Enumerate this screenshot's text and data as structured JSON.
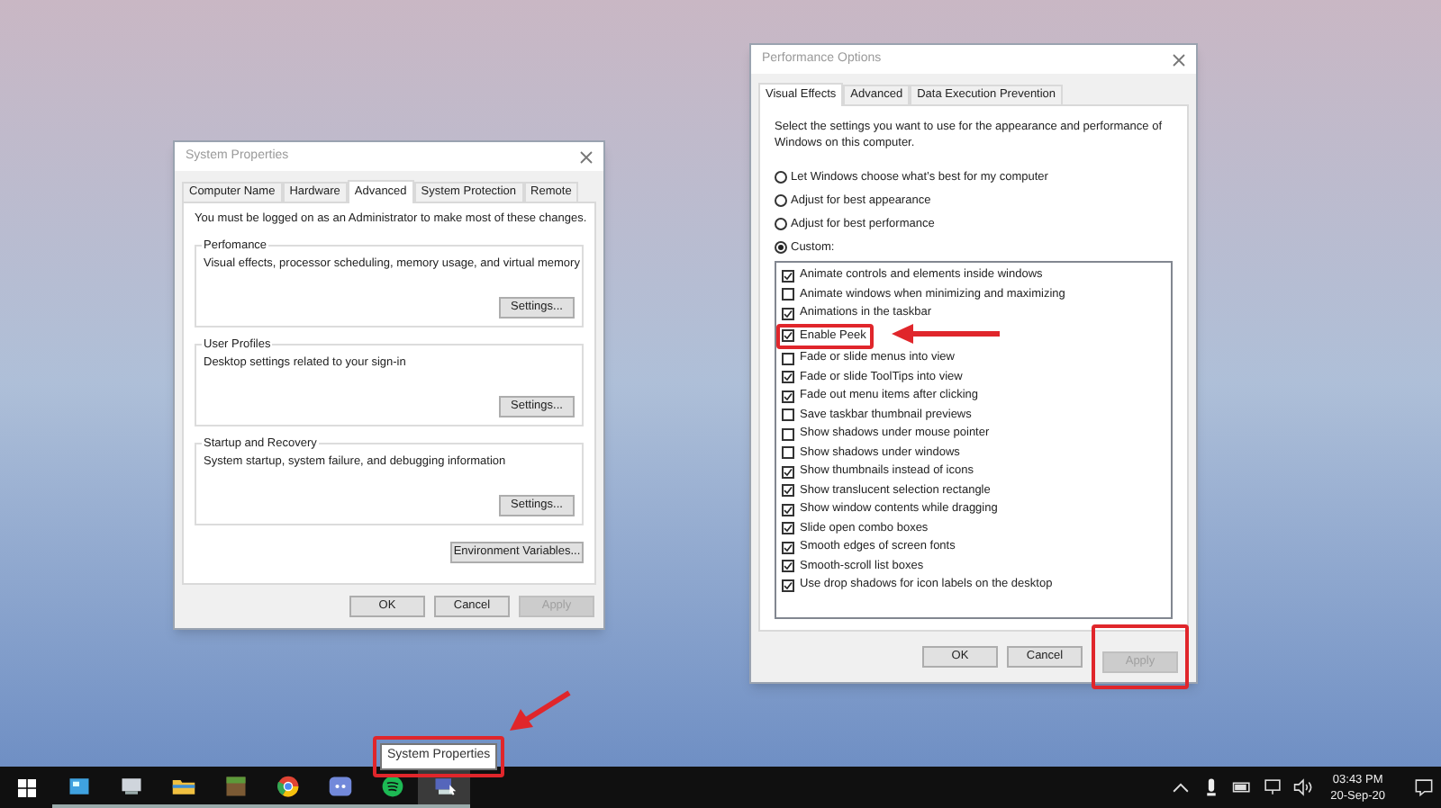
{
  "system_properties": {
    "title": "System Properties",
    "tabs": [
      {
        "label": "Computer Name",
        "selected": false
      },
      {
        "label": "Hardware",
        "selected": false
      },
      {
        "label": "Advanced",
        "selected": true
      },
      {
        "label": "System Protection",
        "selected": false
      },
      {
        "label": "Remote",
        "selected": false
      }
    ],
    "notice": "You must be logged on as an Administrator to make most of these changes.",
    "groups": [
      {
        "title": "Perfomance",
        "description": "Visual effects, processor scheduling, memory usage, and virtual memory",
        "button": "Settings..."
      },
      {
        "title": "User Profiles",
        "description": "Desktop settings related to your sign-in",
        "button": "Settings..."
      },
      {
        "title": "Startup and Recovery",
        "description": "System startup, system failure, and debugging information",
        "button": "Settings..."
      }
    ],
    "env_button": "Environment Variables...",
    "buttons": [
      {
        "label": "OK",
        "disabled": false
      },
      {
        "label": "Cancel",
        "disabled": false
      },
      {
        "label": "Apply",
        "disabled": true
      }
    ]
  },
  "performance_options": {
    "title": "Performance Options",
    "tabs": [
      {
        "label": "Visual Effects",
        "selected": true
      },
      {
        "label": "Advanced",
        "selected": false
      },
      {
        "label": "Data Execution Prevention",
        "selected": false
      }
    ],
    "intro": "Select the settings you want to use for the appearance and performance of Windows on this computer.",
    "options": [
      {
        "label": "Let Windows choose what’s best for my computer",
        "selected": false
      },
      {
        "label": "Adjust for best appearance",
        "selected": false
      },
      {
        "label": "Adjust for best performance",
        "selected": false
      },
      {
        "label": "Custom:",
        "selected": true
      }
    ],
    "effects": [
      {
        "label": "Animate controls and elements inside windows",
        "checked": true,
        "highlighted": false
      },
      {
        "label": "Animate windows when minimizing and maximizing",
        "checked": false,
        "highlighted": false
      },
      {
        "label": "Animations in the taskbar",
        "checked": true,
        "highlighted": false
      },
      {
        "label": "Enable Peek",
        "checked": true,
        "highlighted": true
      },
      {
        "label": "Fade or slide menus into view",
        "checked": false,
        "highlighted": false
      },
      {
        "label": "Fade or slide ToolTips into view",
        "checked": true,
        "highlighted": false
      },
      {
        "label": "Fade out menu items after clicking",
        "checked": true,
        "highlighted": false
      },
      {
        "label": "Save taskbar thumbnail previews",
        "checked": false,
        "highlighted": false
      },
      {
        "label": "Show shadows under mouse pointer",
        "checked": false,
        "highlighted": false
      },
      {
        "label": "Show shadows under windows",
        "checked": false,
        "highlighted": false
      },
      {
        "label": "Show thumbnails instead of icons",
        "checked": true,
        "highlighted": false
      },
      {
        "label": "Show translucent selection rectangle",
        "checked": true,
        "highlighted": false
      },
      {
        "label": "Show window contents while dragging",
        "checked": true,
        "highlighted": false
      },
      {
        "label": "Slide open combo boxes",
        "checked": true,
        "highlighted": false
      },
      {
        "label": "Smooth edges of screen fonts",
        "checked": true,
        "highlighted": false
      },
      {
        "label": "Smooth-scroll list boxes",
        "checked": true,
        "highlighted": false
      },
      {
        "label": "Use drop shadows for icon labels on the desktop",
        "checked": true,
        "highlighted": false
      }
    ],
    "buttons": [
      {
        "label": "OK",
        "disabled": false,
        "highlighted": false
      },
      {
        "label": "Cancel",
        "disabled": false,
        "highlighted": false
      },
      {
        "label": "Apply",
        "disabled": true,
        "highlighted": true
      }
    ]
  },
  "tooltip": {
    "text": "System Properties",
    "highlighted": true
  },
  "taskbar": {
    "apps": [
      {
        "kind": "window",
        "selected": false
      },
      {
        "kind": "computer",
        "selected": false
      },
      {
        "kind": "folder",
        "selected": false
      },
      {
        "kind": "cube",
        "selected": false
      },
      {
        "kind": "browser",
        "selected": false
      },
      {
        "kind": "chat",
        "selected": false
      },
      {
        "kind": "music",
        "selected": false
      },
      {
        "kind": "monitor",
        "selected": true
      }
    ],
    "time": "03:43 PM",
    "date": "20-Sep-20"
  }
}
